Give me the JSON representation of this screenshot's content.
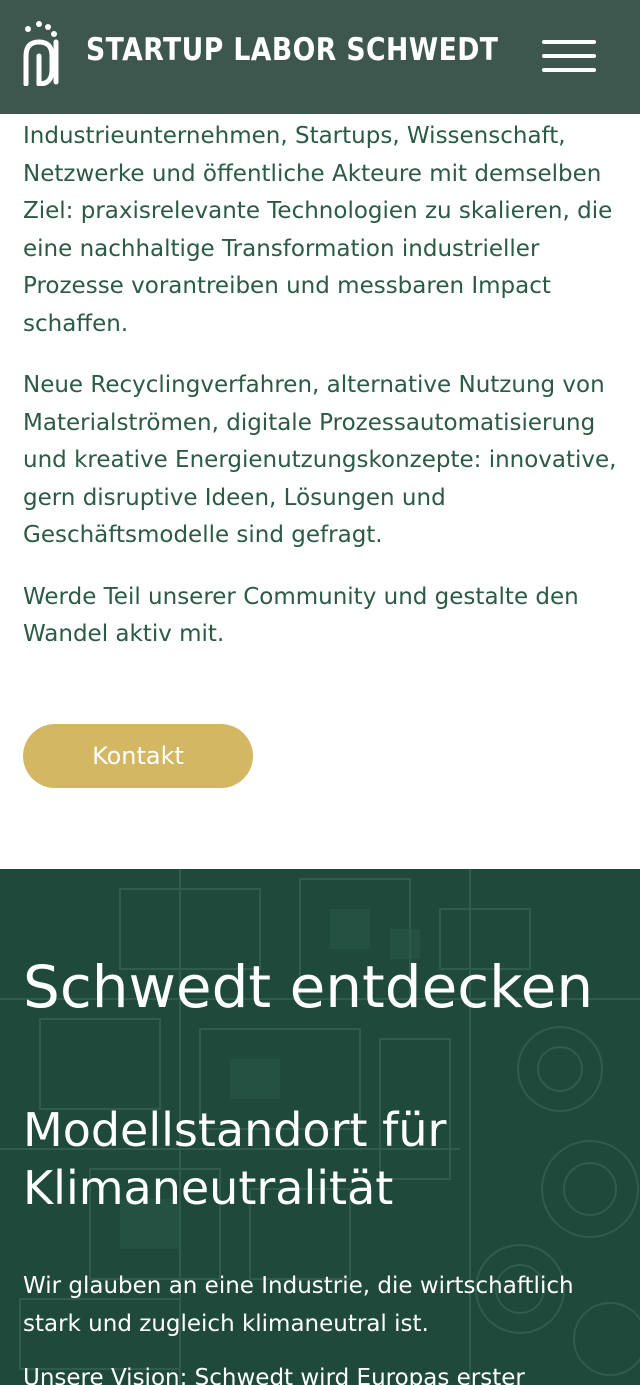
{
  "header": {
    "brand": "STARTUP LABOR SCHWEDT",
    "logo_icon": "startup-labor-logo",
    "menu_icon": "hamburger-menu-icon",
    "background": "#3d574f"
  },
  "intro": {
    "paragraphs": [
      "Industrieunternehmen, Startups, Wissenschaft, Netzwerke und öffentliche Akteure mit demselben Ziel: praxisrelevante Technologien zu skalieren, die eine nachhaltige Transformation industrieller Prozesse vorantreiben und messbaren Impact schaffen.",
      "Neue Recyclingverfahren, alternative Nutzung von Materialströmen, digitale Prozessautomatisierung und kreative Energienutzungskonzepte: innovative, gern disruptive Ideen, Lösungen und Geschäftsmodelle sind gefragt.",
      "Werde Teil unserer Community und gestalte den Wandel aktiv mit."
    ],
    "text_color": "#2b5a45"
  },
  "contact_button": {
    "label": "Kontakt",
    "color": "#d4b762"
  },
  "discover": {
    "title": "Schwedt entdecken",
    "subtitle": "Modellstandort für Klimaneutralität",
    "paragraphs": [
      "Wir glauben an eine Industrie, die wirtschaftlich stark und zugleich klimaneutral ist.",
      "Unsere Vision: Schwedt wird Europas erster"
    ],
    "background": "#1f4a3b"
  }
}
